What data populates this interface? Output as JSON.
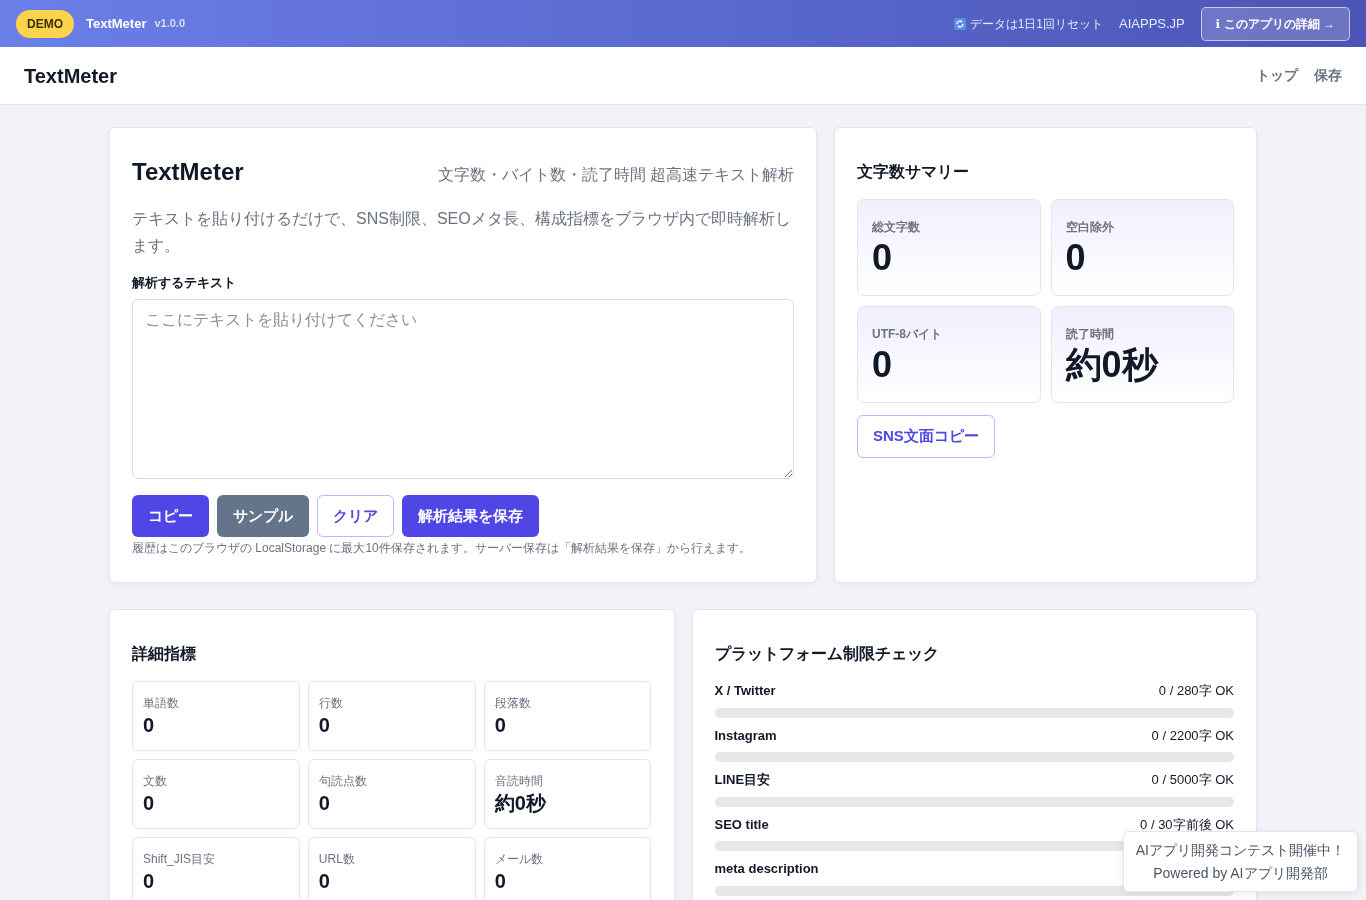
{
  "topbar": {
    "badge": "DEMO",
    "app_name": "TextMeter",
    "version": "v1.0.0",
    "reset_note": "データは1日1回リセット",
    "site": "AIAPPS.JP",
    "about_button": "ℹ このアプリの詳細 →"
  },
  "navbar": {
    "brand": "TextMeter",
    "links": [
      "トップ",
      "保存"
    ]
  },
  "editor": {
    "title": "TextMeter",
    "tagline": "文字数・バイト数・読了時間 超高速テキスト解析",
    "description": "テキストを貼り付けるだけで、SNS制限、SEOメタ長、構成指標をブラウザ内で即時解析します。",
    "field_label": "解析するテキスト",
    "placeholder": "ここにテキストを貼り付けてください",
    "buttons": [
      {
        "label": "コピー",
        "kind": "primary"
      },
      {
        "label": "サンプル",
        "kind": "secondary"
      },
      {
        "label": "クリア",
        "kind": "outline"
      },
      {
        "label": "解析結果を保存",
        "kind": "primary"
      }
    ],
    "note": "履歴はこのブラウザの LocalStorage に最大10件保存されます。サーバー保存は「解析結果を保存」から行えます。"
  },
  "summary": {
    "title": "文字数サマリー",
    "stats": [
      {
        "label": "総文字数",
        "value": "0"
      },
      {
        "label": "空白除外",
        "value": "0"
      },
      {
        "label": "UTF-8バイト",
        "value": "0"
      },
      {
        "label": "読了時間",
        "value": "約0秒"
      }
    ],
    "copy_button": "SNS文面コピー"
  },
  "details": {
    "title": "詳細指標",
    "metrics": [
      {
        "label": "単語数",
        "value": "0"
      },
      {
        "label": "行数",
        "value": "0"
      },
      {
        "label": "段落数",
        "value": "0"
      },
      {
        "label": "文数",
        "value": "0"
      },
      {
        "label": "句読点数",
        "value": "0"
      },
      {
        "label": "音読時間",
        "value": "約0秒"
      },
      {
        "label": "Shift_JIS目安",
        "value": "0"
      },
      {
        "label": "URL数",
        "value": "0"
      },
      {
        "label": "メール数",
        "value": "0"
      }
    ]
  },
  "platforms": {
    "title": "プラットフォーム制限チェック",
    "items": [
      {
        "name": "X / Twitter",
        "reading": "0 / 280字 OK",
        "level": 0
      },
      {
        "name": "Instagram",
        "reading": "0 / 2200字 OK",
        "level": 0
      },
      {
        "name": "LINE目安",
        "reading": "0 / 5000字 OK",
        "level": 0
      },
      {
        "name": "SEO title",
        "reading": "0 / 30字前後 OK",
        "level": 0
      },
      {
        "name": "meta description",
        "level": 0
      }
    ]
  },
  "toast": {
    "lines": [
      "AIアプリ開発コンテスト開催中！",
      "Powered by AIアプリ開発部"
    ]
  }
}
